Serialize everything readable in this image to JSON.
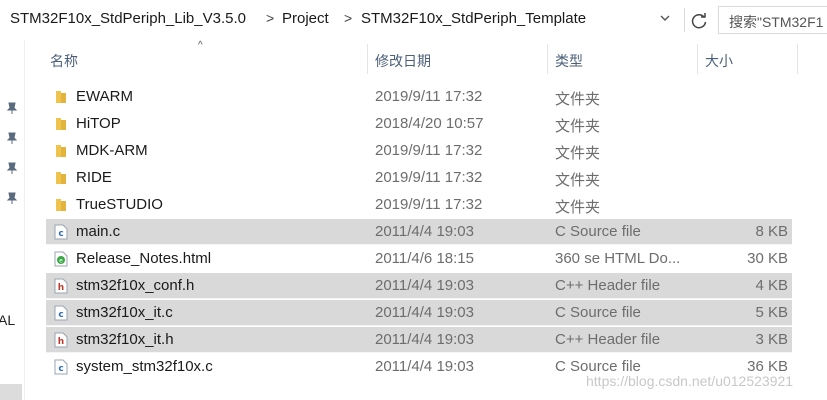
{
  "address_bar": {
    "breadcrumbs": [
      "STM32F10x_StdPeriph_Lib_V3.5.0",
      "Project",
      "STM32F10x_StdPeriph_Template"
    ],
    "separator": ">",
    "dropdown_icon": "chevron-down-icon",
    "refresh_icon": "refresh-icon"
  },
  "search": {
    "text": "搜索\"STM32F1"
  },
  "nav_pane": {
    "pin_icons": [
      "pin-icon",
      "pin-icon",
      "pin-icon",
      "pin-icon"
    ],
    "partial_label": "AL"
  },
  "columns": {
    "name": "名称",
    "date": "修改日期",
    "type": "类型",
    "size": "大小",
    "sort_indicator": "^"
  },
  "files": [
    {
      "name": "EWARM",
      "date": "2019/9/11 17:32",
      "type": "文件夹",
      "size": "",
      "icon": "folder-icon",
      "selected": false
    },
    {
      "name": "HiTOP",
      "date": "2018/4/20 10:57",
      "type": "文件夹",
      "size": "",
      "icon": "folder-icon",
      "selected": false
    },
    {
      "name": "MDK-ARM",
      "date": "2019/9/11 17:32",
      "type": "文件夹",
      "size": "",
      "icon": "folder-icon",
      "selected": false
    },
    {
      "name": "RIDE",
      "date": "2019/9/11 17:32",
      "type": "文件夹",
      "size": "",
      "icon": "folder-icon",
      "selected": false
    },
    {
      "name": "TrueSTUDIO",
      "date": "2019/9/11 17:32",
      "type": "文件夹",
      "size": "",
      "icon": "folder-icon",
      "selected": false
    },
    {
      "name": "main.c",
      "date": "2011/4/4 19:03",
      "type": "C Source file",
      "size": "8 KB",
      "icon": "c-file-icon",
      "selected": true
    },
    {
      "name": "Release_Notes.html",
      "date": "2011/4/6 18:15",
      "type": "360 se HTML Do...",
      "size": "30 KB",
      "icon": "html-file-icon",
      "selected": false
    },
    {
      "name": "stm32f10x_conf.h",
      "date": "2011/4/4 19:03",
      "type": "C++ Header file",
      "size": "4 KB",
      "icon": "h-file-icon",
      "selected": true
    },
    {
      "name": "stm32f10x_it.c",
      "date": "2011/4/4 19:03",
      "type": "C Source file",
      "size": "5 KB",
      "icon": "c-file-icon",
      "selected": true
    },
    {
      "name": "stm32f10x_it.h",
      "date": "2011/4/4 19:03",
      "type": "C++ Header file",
      "size": "3 KB",
      "icon": "h-file-icon",
      "selected": true
    },
    {
      "name": "system_stm32f10x.c",
      "date": "2011/4/4 19:03",
      "type": "C Source file",
      "size": "36 KB",
      "icon": "c-file-icon",
      "selected": false
    }
  ],
  "watermark": "https://blog.csdn.net/u012523921",
  "colors": {
    "selection": "#d9d9d9",
    "folder": "#f0c44c",
    "header_text": "#4c607a",
    "h_icon": "#c0392b",
    "c_icon": "#2f6fb5",
    "html_icon": "#3aa845"
  }
}
